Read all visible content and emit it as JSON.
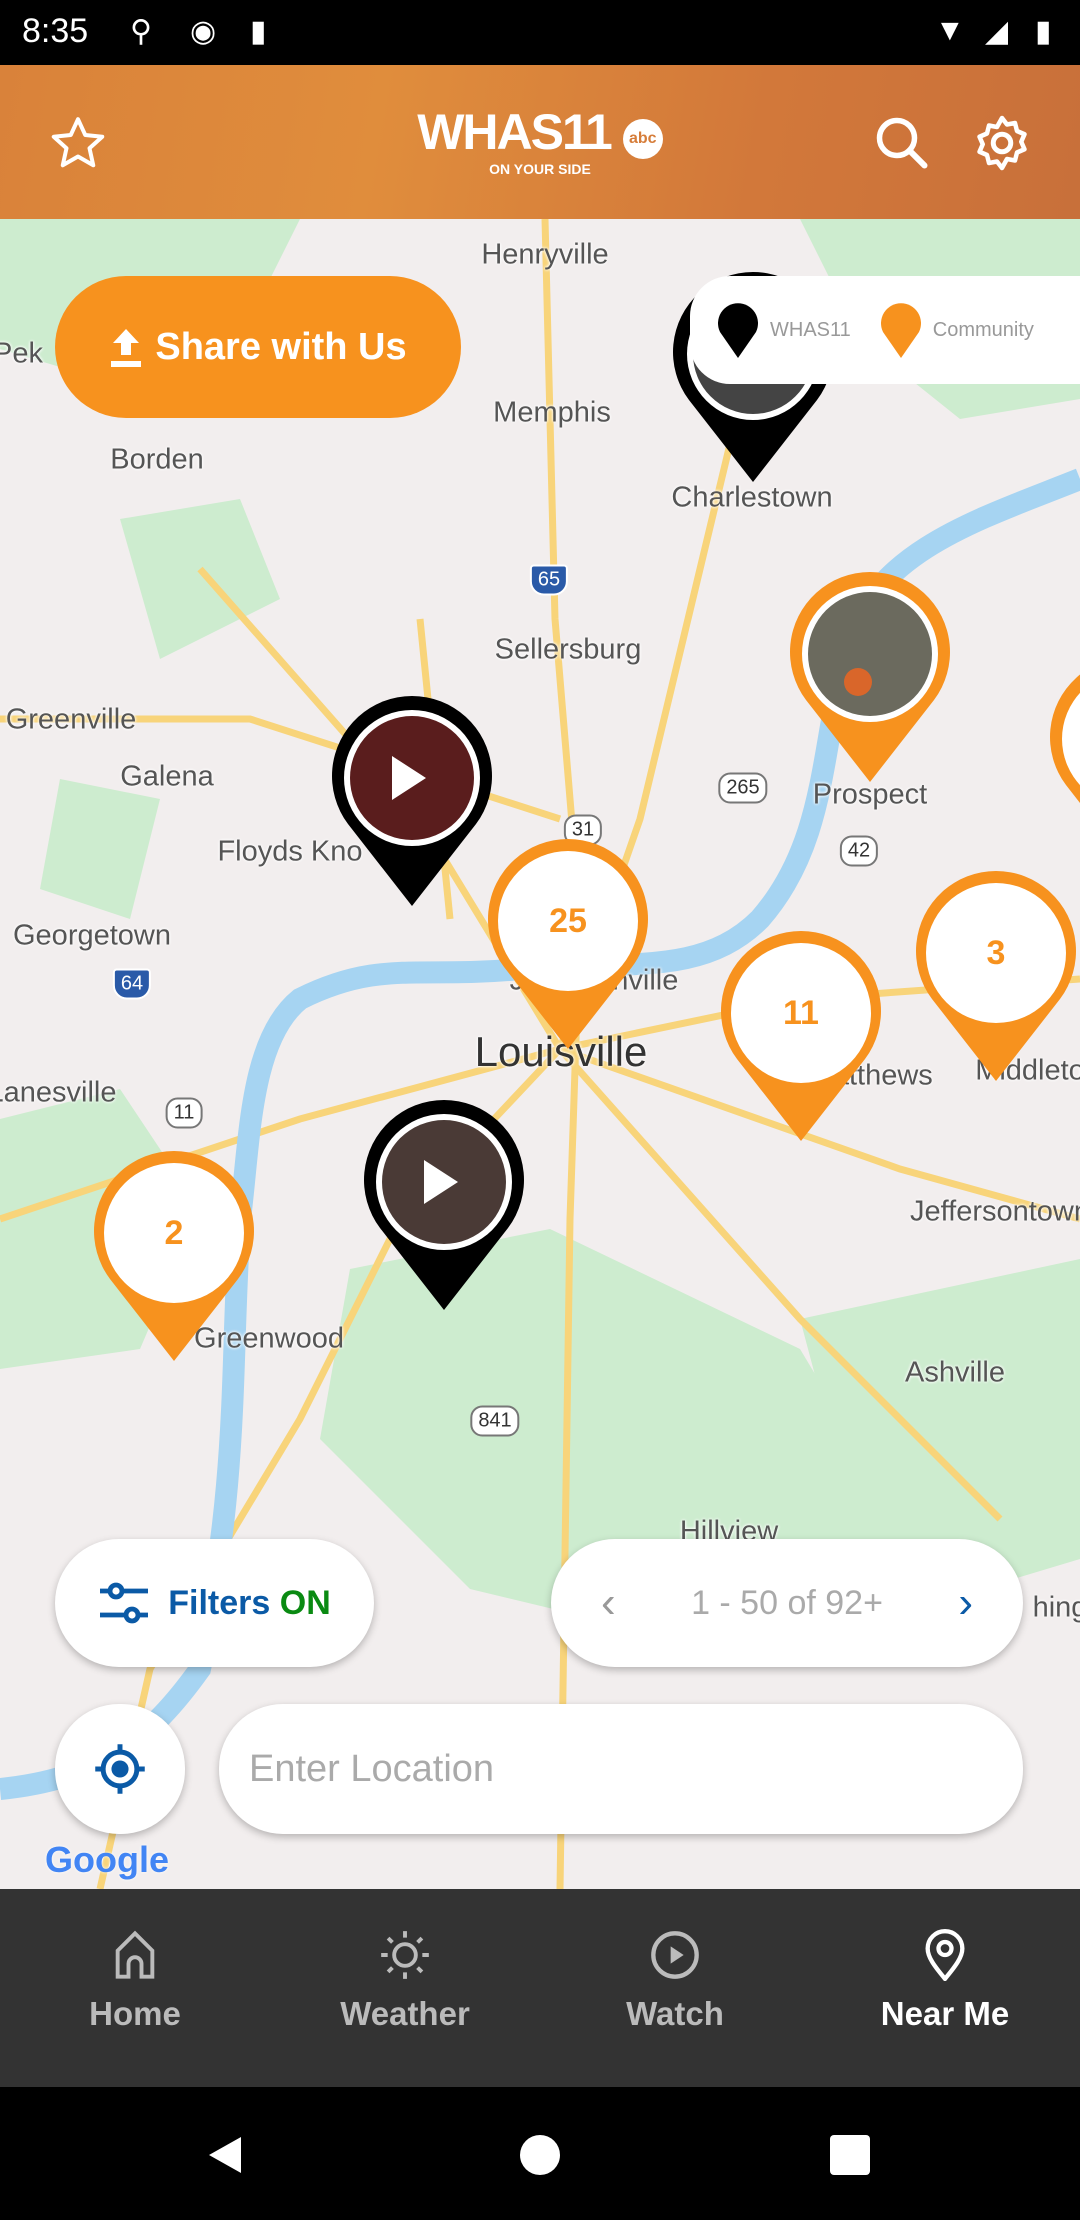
{
  "status_bar": {
    "time": "8:35"
  },
  "header": {
    "logo_text": "WHAS11",
    "logo_network": "abc",
    "logo_tagline": "ON YOUR SIDE"
  },
  "map": {
    "labels": [
      "Henryville",
      "Pek",
      "Memphis",
      "Borden",
      "Charlestown",
      "Sellersburg",
      "Greenville",
      "Galena",
      "Floyds Kno",
      "Prospect",
      "Georgetown",
      "Jeffersonville",
      "Louisville",
      "St. Matthews",
      "Middleto",
      "Lanesville",
      "Jeffersontown",
      "Greenwood",
      "Ashville",
      "Hillview",
      "hing"
    ],
    "shields": [
      "65",
      "265",
      "31",
      "42",
      "64",
      "11",
      "841"
    ],
    "clusters": [
      "25",
      "11",
      "3",
      "2"
    ],
    "attribution": "Google"
  },
  "share_button": {
    "label": "Share with Us"
  },
  "legend": {
    "items": [
      {
        "label": "WHAS11",
        "color": "#000000"
      },
      {
        "label": "Community",
        "color": "#f7921e"
      }
    ]
  },
  "filters": {
    "label": "Filters",
    "state": "ON"
  },
  "pager": {
    "text": "1 - 50 of 92+"
  },
  "location_input": {
    "placeholder": "Enter Location",
    "value": ""
  },
  "bottom_nav": {
    "items": [
      {
        "label": "Home"
      },
      {
        "label": "Weather"
      },
      {
        "label": "Watch"
      },
      {
        "label": "Near Me",
        "active": true
      }
    ]
  },
  "colors": {
    "accent": "#f7921e",
    "brand_blue": "#0b5aa6",
    "on_green": "#0a8a12",
    "nav_bg": "#333333"
  }
}
